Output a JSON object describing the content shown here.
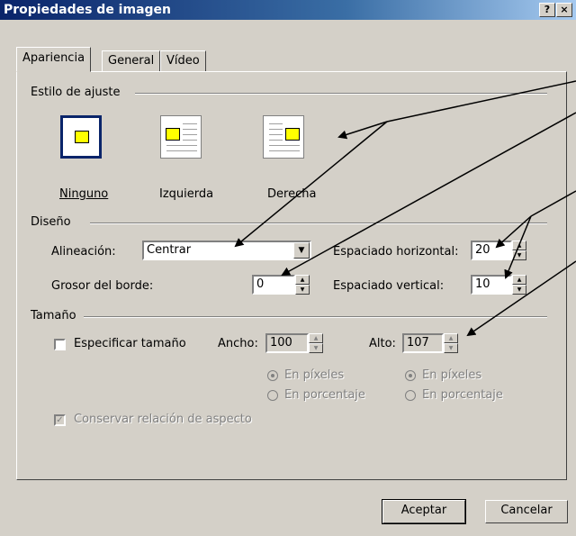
{
  "window": {
    "title": "Propiedades de imagen",
    "help": "?",
    "close": "×"
  },
  "tabs": [
    "Apariencia",
    "General",
    "Vídeo"
  ],
  "sections": {
    "wrap": "Estilo de ajuste",
    "design": "Diseño",
    "size": "Tamaño"
  },
  "wrap_styles": [
    "Ninguno",
    "Izquierda",
    "Derecha"
  ],
  "design": {
    "align_label": "Alineación:",
    "align_value": "Centrar",
    "border_label": "Grosor del borde:",
    "border_value": "0",
    "hspace_label": "Espaciado horizontal:",
    "hspace_value": "20",
    "vspace_label": "Espaciado vertical:",
    "vspace_value": "10"
  },
  "size": {
    "specify_label": "Especificar tamaño",
    "width_label": "Ancho:",
    "width_value": "100",
    "height_label": "Alto:",
    "height_value": "107",
    "pixels": "En píxeles",
    "percent": "En porcentaje",
    "aspect_label": "Conservar relación de aspecto"
  },
  "buttons": {
    "ok": "Aceptar",
    "cancel": "Cancelar"
  },
  "colors": {
    "face": "#d4d0c8",
    "title_start": "#0a246a",
    "selection": "#0a246a",
    "swatch": "#ffff00"
  }
}
